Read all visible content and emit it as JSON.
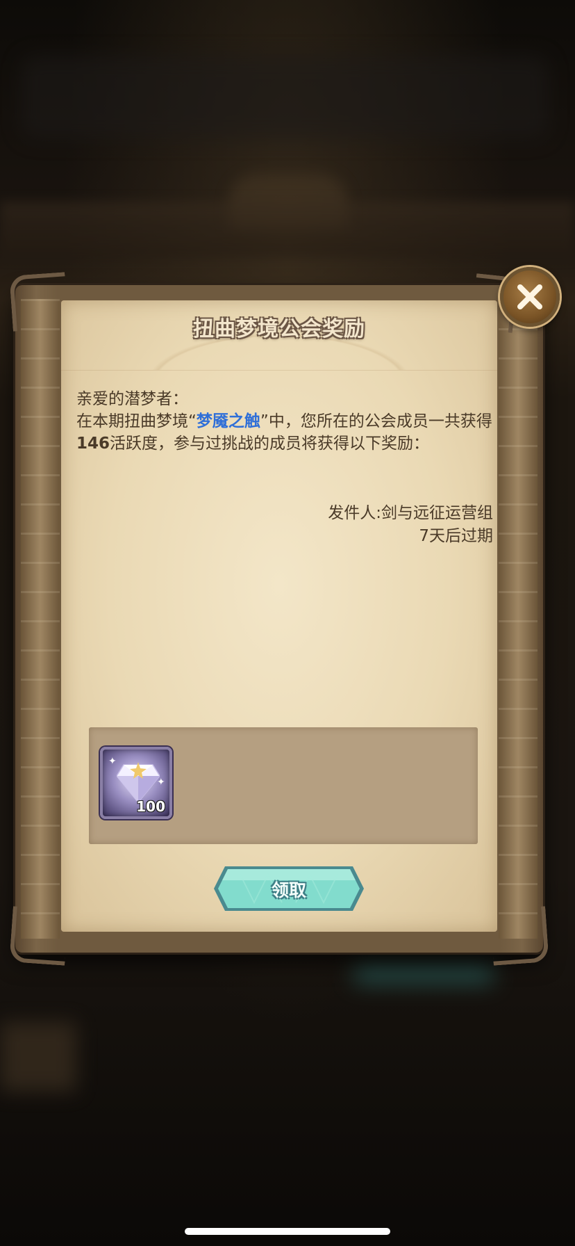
{
  "dialog": {
    "title": "扭曲梦境公会奖励",
    "greeting": "亲爱的潜梦者：",
    "body_prefix": "在本期扭曲梦境“",
    "dream_name": "梦魇之触",
    "body_middle": "”中，您所在的公会成员一共获得",
    "activity_points": "146",
    "body_suffix": "活跃度，参与过挑战的成员将获得以下奖励：",
    "sender": "发件人:剑与远征运营组",
    "expiry": "7天后过期"
  },
  "reward": {
    "items": [
      {
        "icon": "diamond-gem-icon",
        "count": "100"
      }
    ]
  },
  "buttons": {
    "claim_label": "领取",
    "close_icon": "close-x-icon"
  },
  "colors": {
    "highlight": "#2f6fd8",
    "body_text": "#4a3a28",
    "claim_button": "#6fd3c4",
    "parchment": "#ead9b4"
  }
}
